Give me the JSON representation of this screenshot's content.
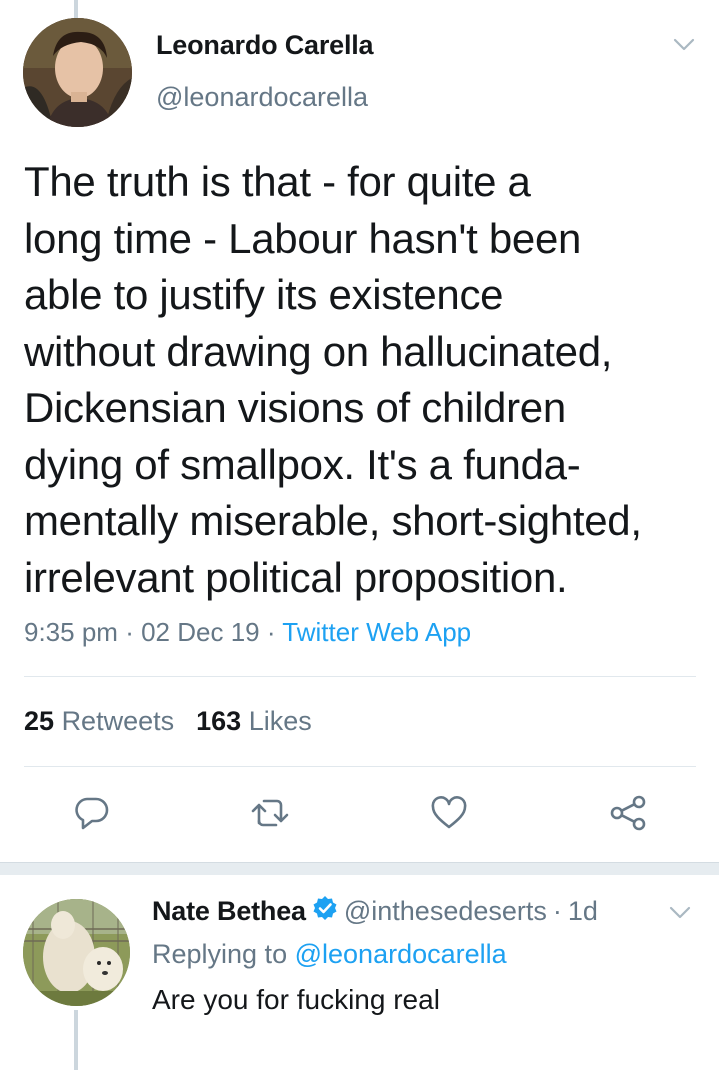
{
  "tweet": {
    "author_name": "Leonardo Carella",
    "author_handle": "@leonardocarella",
    "text_lines": [
      "The truth is that - for quite a",
      "long time - Labour hasn't been",
      "able to justify its existence",
      "without drawing on hallucinated,",
      "Dickensian visions of children",
      "dying of smallpox. It's a funda-",
      "mentally miserable, short-sighted,",
      "irrelevant political proposition."
    ],
    "time": "9:35 pm",
    "date": "02 Dec 19",
    "source": "Twitter Web App",
    "separator": "·",
    "retweets_count": "25",
    "retweets_label": "Retweets",
    "likes_count": "163",
    "likes_label": "Likes"
  },
  "reply": {
    "author_name": "Nate Bethea",
    "author_handle": "@inthesedeserts",
    "separator": "·",
    "time": "1d",
    "replying_to_label": "Replying to",
    "replying_to_handle": "@leonardocarella",
    "text": "Are you for fucking real"
  },
  "icons": {
    "reply": "reply-icon",
    "retweet": "retweet-icon",
    "like": "heart-icon",
    "share": "share-icon",
    "caret": "chevron-down-icon",
    "verified": "verified-badge-icon"
  },
  "colors": {
    "link": "#1da1f2",
    "secondary_text": "#657786",
    "primary_text": "#14171a",
    "icon_gray": "#657786",
    "divider": "#e1e8ed"
  }
}
